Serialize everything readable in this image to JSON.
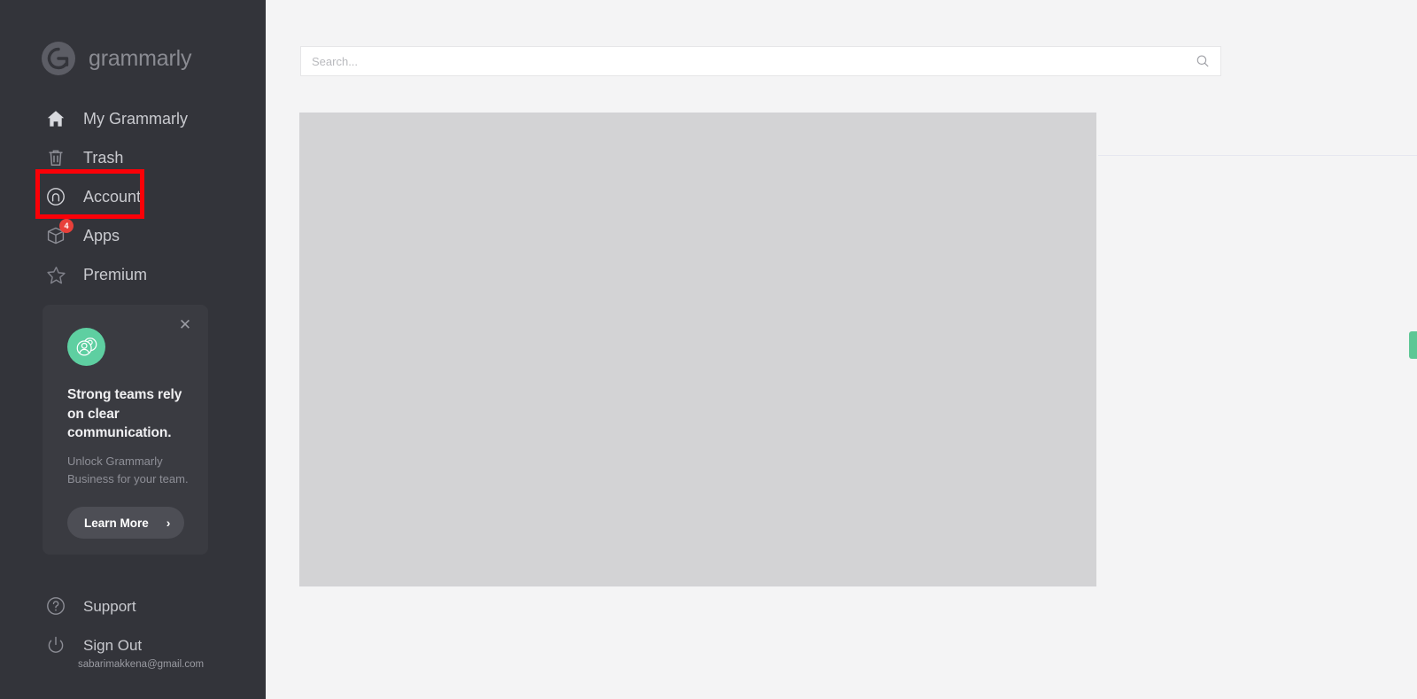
{
  "app": {
    "name": "Grammarly",
    "brand_text": "grammarly",
    "brand_icon": "grammarly-g-logo-icon"
  },
  "colors": {
    "sidebar_bg": "#33343a",
    "main_bg": "#f4f4f5",
    "content_placeholder": "#d3d3d5",
    "highlight_red": "#fb0007",
    "badge_red": "#e8403a",
    "accent_green": "#5ecfa1",
    "handle_green": "#5ec795",
    "divider": "#e6e7f0"
  },
  "sidebar": {
    "items": [
      {
        "label": "My Grammarly",
        "icon": "home-icon",
        "badge": ""
      },
      {
        "label": "Trash",
        "icon": "trash-icon",
        "badge": ""
      },
      {
        "label": "Account",
        "icon": "account-circle-icon",
        "badge": ""
      },
      {
        "label": "Apps",
        "icon": "box-icon",
        "badge": "4"
      },
      {
        "label": "Premium",
        "icon": "star-icon",
        "badge": ""
      }
    ],
    "highlighted_item": "Account",
    "promo": {
      "close_icon": "close-icon",
      "avatar_icon": "team-group-icon",
      "title": "Strong teams rely on clear communication.",
      "subtitle": "Unlock Grammarly Business for your team.",
      "button_label": "Learn More",
      "button_chevron": "›"
    },
    "footer": {
      "items": [
        {
          "label": "Support",
          "icon": "question-circle-icon"
        },
        {
          "label": "Sign Out",
          "icon": "power-icon"
        }
      ],
      "account_email": "sabarimakkena@gmail.com"
    }
  },
  "main": {
    "search": {
      "placeholder": "Search...",
      "value": "",
      "icon": "search-icon"
    },
    "content_placeholder_label": "",
    "side_handle_name": "feedback-tab-handle"
  }
}
